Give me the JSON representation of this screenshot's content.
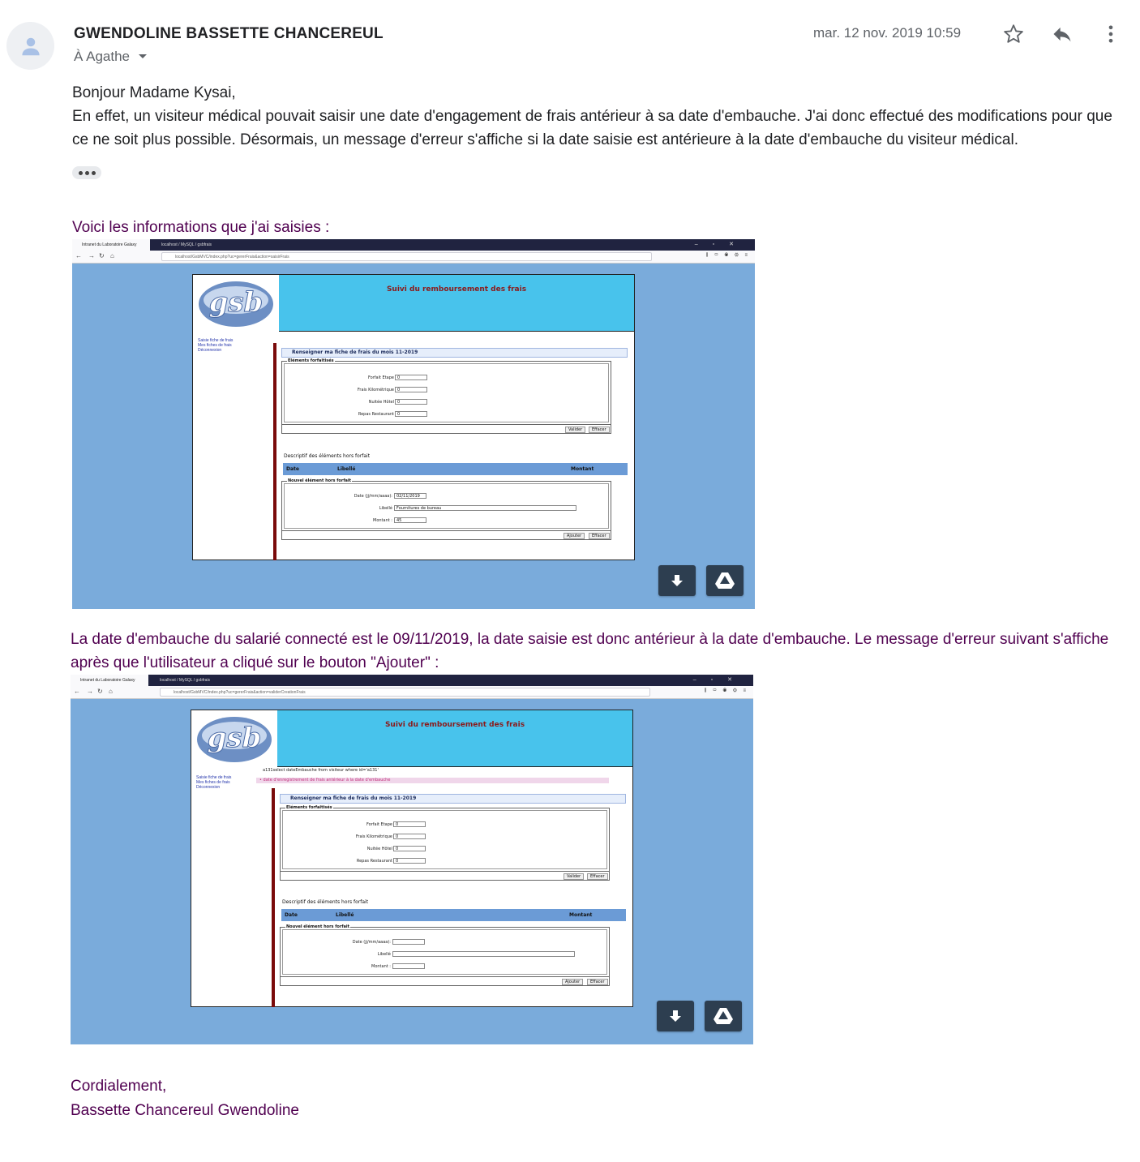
{
  "email": {
    "sender": "GWENDOLINE BASSETTE CHANCEREUL",
    "recipient": "À Agathe",
    "date": "mar. 12 nov. 2019 10:59",
    "greeting": "Bonjour Madame Kysai,",
    "paragraph1": "En effet, un visiteur médical pouvait saisir une date d'engagement de frais antérieur à sa date d'embauche. J'ai donc effectué des modifications pour que ce ne soit plus possible. Désormais, un message d'erreur s'affiche si la date saisie est antérieure à la date d'embauche du visiteur médical.",
    "intro1": "Voici les informations que j'ai saisies :",
    "intro2": "La date d'embauche du salarié connecté est le 09/11/2019, la date saisie est donc antérieur à la date d'embauche. Le message d'erreur suivant s'affiche après que l'utilisateur a cliqué sur le bouton \"Ajouter\" :",
    "closing": "Cordialement,",
    "signature": "Bassette Chancereul Gwendoline"
  },
  "browser": {
    "tab1": "Intranet du Laboratoire Galaxy",
    "tab2": "localhost / MySQL / gsbfrais",
    "url1": "localhost/GsbMVC/index.php?uc=gererFrais&action=saisirFrais",
    "url2": "localhost/GsbMVC/index.php?uc=gererFrais&action=validerCreationFrais"
  },
  "app": {
    "logo": "gsb",
    "title": "Suivi du remboursement des frais",
    "menu": [
      "Saisie fiche de frais",
      "Mes fiches de frais",
      "Déconnexion"
    ],
    "section_title": "Renseigner ma fiche de frais du mois 11-2019",
    "forfait_legend": "Eléments forfaitisés",
    "forfait_fields": [
      {
        "label": "Forfait Etape",
        "value": "0"
      },
      {
        "label": "Frais Kilométrique",
        "value": "0"
      },
      {
        "label": "Nuitée Hôtel",
        "value": "0"
      },
      {
        "label": "Repas Restaurant",
        "value": "0"
      }
    ],
    "valider": "Valider",
    "effacer": "Effacer",
    "hf_title": "Descriptif des éléments hors forfait",
    "col_date": "Date",
    "col_libelle": "Libellé",
    "col_montant": "Montant",
    "new_legend": "Nouvel élément hors forfait",
    "lbl_date": "Date (jj/mm/aaaa):",
    "lbl_libelle": "Libellé",
    "lbl_montant": "Montant :",
    "val_date": "02/11/2019",
    "val_libelle": "Fournitures de bureau",
    "val_montant": "45",
    "ajouter": "Ajouter",
    "sql_debug": "a131select dateEmbauche from visiteur where id='a131'",
    "error_msg": "date d'enregistrement de frais antérieur à la date d'embauche"
  },
  "icons": {
    "star": "star-icon",
    "reply": "reply-icon",
    "more": "more-vert-icon",
    "download": "download-icon",
    "drive": "drive-icon"
  }
}
